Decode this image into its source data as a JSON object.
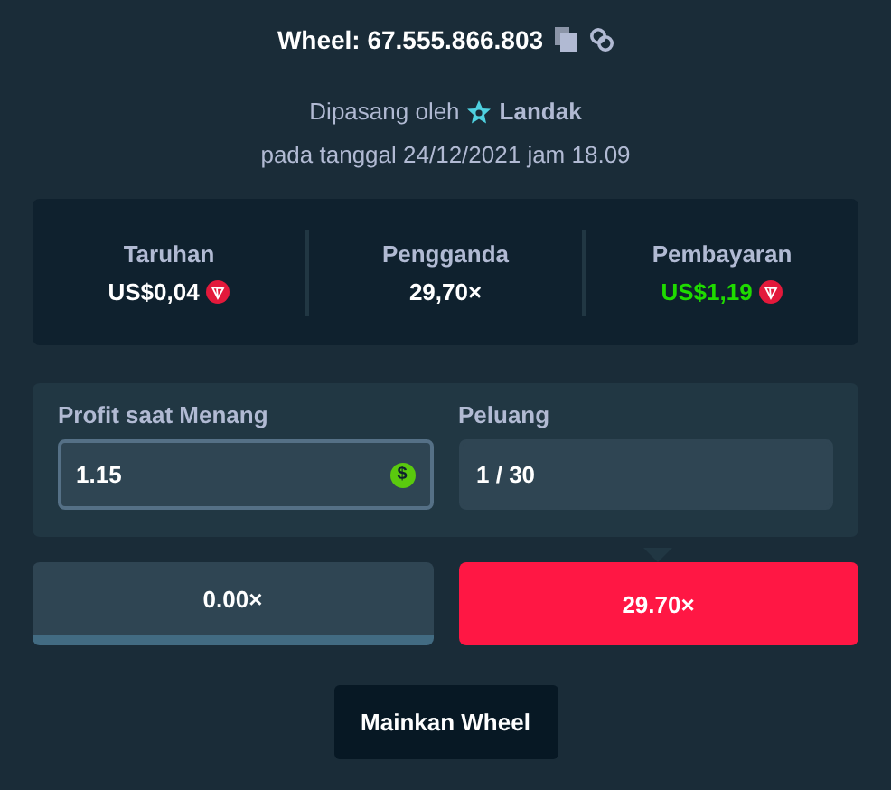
{
  "header": {
    "title": "Wheel: 67.555.866.803",
    "placed_by_label": "Dipasang oleh",
    "user": "Landak",
    "date": "pada tanggal 24/12/2021 jam 18.09"
  },
  "stats": [
    {
      "label": "Taruhan",
      "value": "US$0,04",
      "color": "#ffffff",
      "coin": true
    },
    {
      "label": "Pengganda",
      "value": "29,70×",
      "color": "#ffffff",
      "coin": false
    },
    {
      "label": "Pembayaran",
      "value": "US$1,19",
      "color": "#1fdb00",
      "coin": true
    }
  ],
  "fields": [
    {
      "label": "Profit saat Menang",
      "value": "1.15",
      "focused": true,
      "currency_symbol": "$"
    },
    {
      "label": "Peluang",
      "value": "1 / 30",
      "focused": false
    }
  ],
  "segments": [
    {
      "label": "0.00×",
      "color": "#2f4553",
      "selected": false
    },
    {
      "label": "29.70×",
      "color": "#ff1744",
      "selected": true
    }
  ],
  "play_button": "Mainkan Wheel"
}
